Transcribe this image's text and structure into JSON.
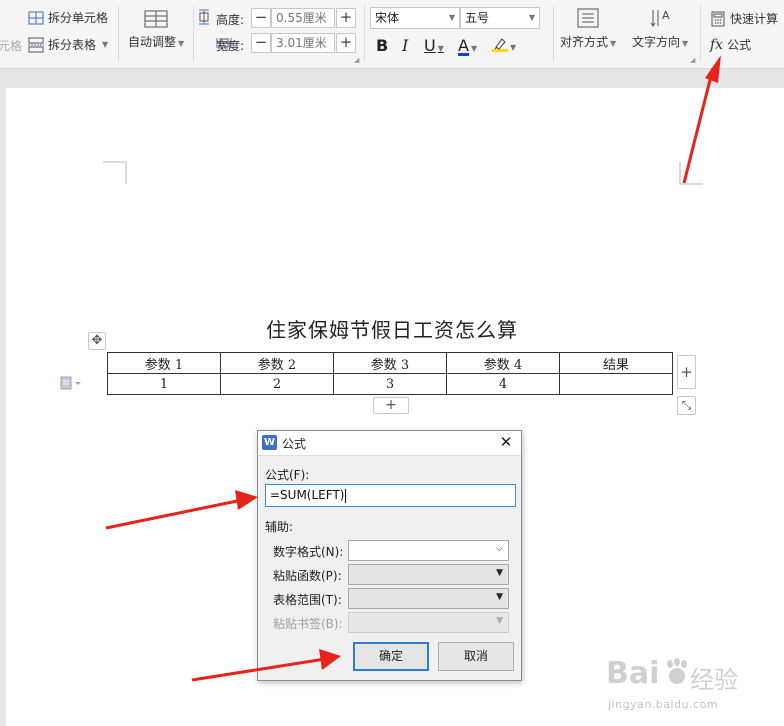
{
  "ribbon": {
    "merge_cells_partial": "元格",
    "split_cell": "拆分单元格",
    "split_table": "拆分表格",
    "auto_adjust": "自动调整",
    "height_label": "高度:",
    "height_value": "0.55厘米",
    "width_label": "宽度:",
    "width_value": "3.01厘米",
    "font_name": "宋体",
    "font_size": "五号",
    "bold": "B",
    "italic": "I",
    "underline": "U",
    "font_color": "A",
    "align": "对齐方式",
    "text_direction": "文字方向",
    "quick_calc": "快速计算",
    "formula": "公式",
    "fx": "fx",
    "minus": "−",
    "plus": "+"
  },
  "document": {
    "title": "住家保姆节假日工资怎么算",
    "table": {
      "headers": [
        "参数 1",
        "参数 2",
        "参数 3",
        "参数 4",
        "结果"
      ],
      "row": [
        "1",
        "2",
        "3",
        "4",
        ""
      ]
    },
    "add_col": "+",
    "add_row": "+",
    "resize": "⤡",
    "move": "✥"
  },
  "dialog": {
    "icon_letter": "W",
    "title": "公式",
    "close": "✕",
    "formula_label": "公式(F):",
    "formula_value": "=SUM(LEFT)",
    "assist_label": "辅助:",
    "number_format_label": "数字格式(N):",
    "paste_function_label": "粘贴函数(P):",
    "table_range_label": "表格范围(T):",
    "paste_bookmark_label": "粘贴书签(B):",
    "ok": "确定",
    "cancel": "取消"
  },
  "watermark": {
    "brand": "Bai",
    "brand_cn": "经验",
    "url": "jingyan.baidu.com"
  },
  "colors": {
    "arrow": "#e8231a",
    "accent": "#2f7bd6",
    "font_color_bar": "#1a3fd1",
    "highlight_bar": "#ffd800"
  }
}
